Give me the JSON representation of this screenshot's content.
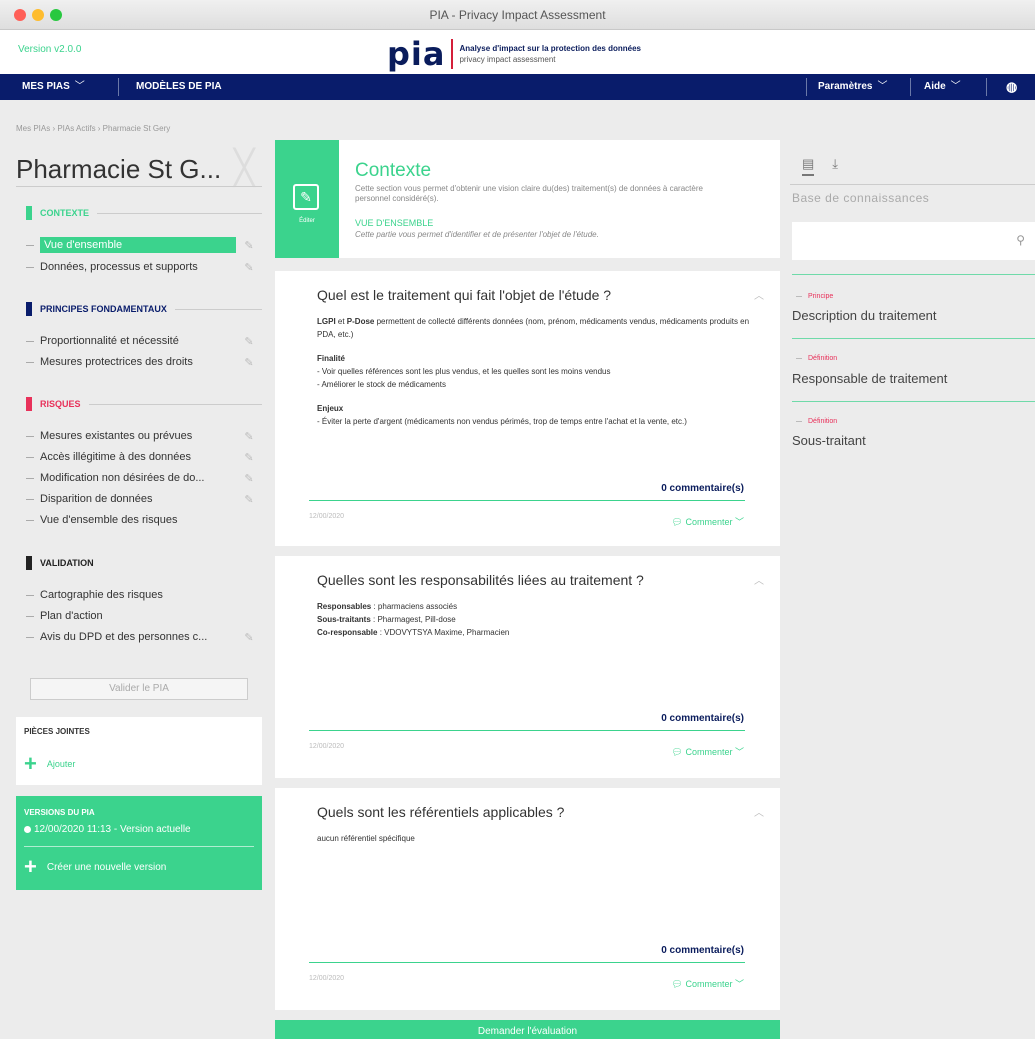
{
  "window": {
    "title": "PIA - Privacy Impact Assessment"
  },
  "header": {
    "version": "Version v2.0.0",
    "logo_word": "pia",
    "tagline_1": "Analyse d'impact sur la protection des données",
    "tagline_2": "privacy impact assessment"
  },
  "nav": {
    "mes_pias": "MES PIAS",
    "modeles": "MODÈLES DE PIA",
    "parametres": "Paramètres",
    "aide": "Aide"
  },
  "breadcrumb": "Mes PIAs › PIAs Actifs › Pharmacie St Gery",
  "sidebar": {
    "pia_title": "Pharmacie St G...",
    "sections": [
      {
        "label": "CONTEXTE",
        "color": "#3bd38d"
      },
      {
        "label": "PRINCIPES FONDAMENTAUX",
        "color": "#091c6b"
      },
      {
        "label": "RISQUES",
        "color": "#e8315a"
      },
      {
        "label": "VALIDATION",
        "color": "#222222"
      }
    ],
    "items": [
      "Vue d'ensemble",
      "Données, processus et supports",
      "Proportionnalité et nécessité",
      "Mesures protectrices des droits",
      "Mesures existantes ou prévues",
      "Accès illégitime à des données",
      "Modification non désirées de do...",
      "Disparition de données",
      "Vue d'ensemble des risques",
      "Cartographie des risques",
      "Plan d'action",
      "Avis du DPD et des personnes c..."
    ],
    "validate_button": "Valider le PIA",
    "attachments_title": "PIÈCES JOINTES",
    "attachments_add": "Ajouter",
    "versions_title": "VERSIONS DU PIA",
    "versions_current": "12/00/2020 11:13 - Version actuelle",
    "versions_new": "Créer une nouvelle version"
  },
  "context": {
    "side_label": "Éditer",
    "title": "Contexte",
    "description": "Cette section vous permet d'obtenir une vision claire du(des) traitement(s) de données à caractère personnel considéré(s).",
    "subtitle": "VUE D'ENSEMBLE",
    "subdescription": "Cette partie vous permet d'identifier et de présenter l'objet de l'étude."
  },
  "questions": [
    {
      "title": "Quel est le traitement qui fait l'objet de l'étude ?",
      "p1_b1": "LGPI",
      "p1_t1": " et ",
      "p1_b2": "P-Dose",
      "p1_t2": " permettent de collecté différents données (nom, prénom, médicaments vendus, médicaments produits en PDA, etc.)",
      "p2_head": "Finalité",
      "p2_l1": "- Voir quelles références sont les plus vendus, et les quelles sont les moins vendus",
      "p2_l2": "- Améliorer le stock de médicaments",
      "p3_head": "Enjeux",
      "p3_l1": "- Éviter la perte d'argent (médicaments non vendus périmés, trop de temps entre l'achat et la vente, etc.)",
      "comments": "0 commentaire(s)",
      "date": "12/00/2020",
      "comment_action": "Commenter"
    },
    {
      "title": "Quelles sont les responsabilités liées au traitement ?",
      "r1_b": "Responsables",
      "r1_t": " : pharmaciens associés",
      "r2_b": "Sous-traitants",
      "r2_t": " : Pharmagest, Pill-dose",
      "r3_b": "Co-responsable",
      "r3_t": " : VDOVYTSYA Maxime, Pharmacien",
      "comments": "0 commentaire(s)",
      "date": "12/00/2020",
      "comment_action": "Commenter"
    },
    {
      "title": "Quels sont les référentiels applicables ?",
      "body": "aucun référentiel spécifique",
      "comments": "0 commentaire(s)",
      "date": "12/00/2020",
      "comment_action": "Commenter"
    }
  ],
  "evaluation_button": "Demander l'évaluation",
  "knowledge": {
    "title": "Base de connaissances",
    "search_placeholder": "",
    "items": [
      {
        "category": "Principe",
        "name": "Description du traitement"
      },
      {
        "category": "Définition",
        "name": "Responsable de traitement"
      },
      {
        "category": "Définition",
        "name": "Sous-traitant"
      }
    ]
  }
}
